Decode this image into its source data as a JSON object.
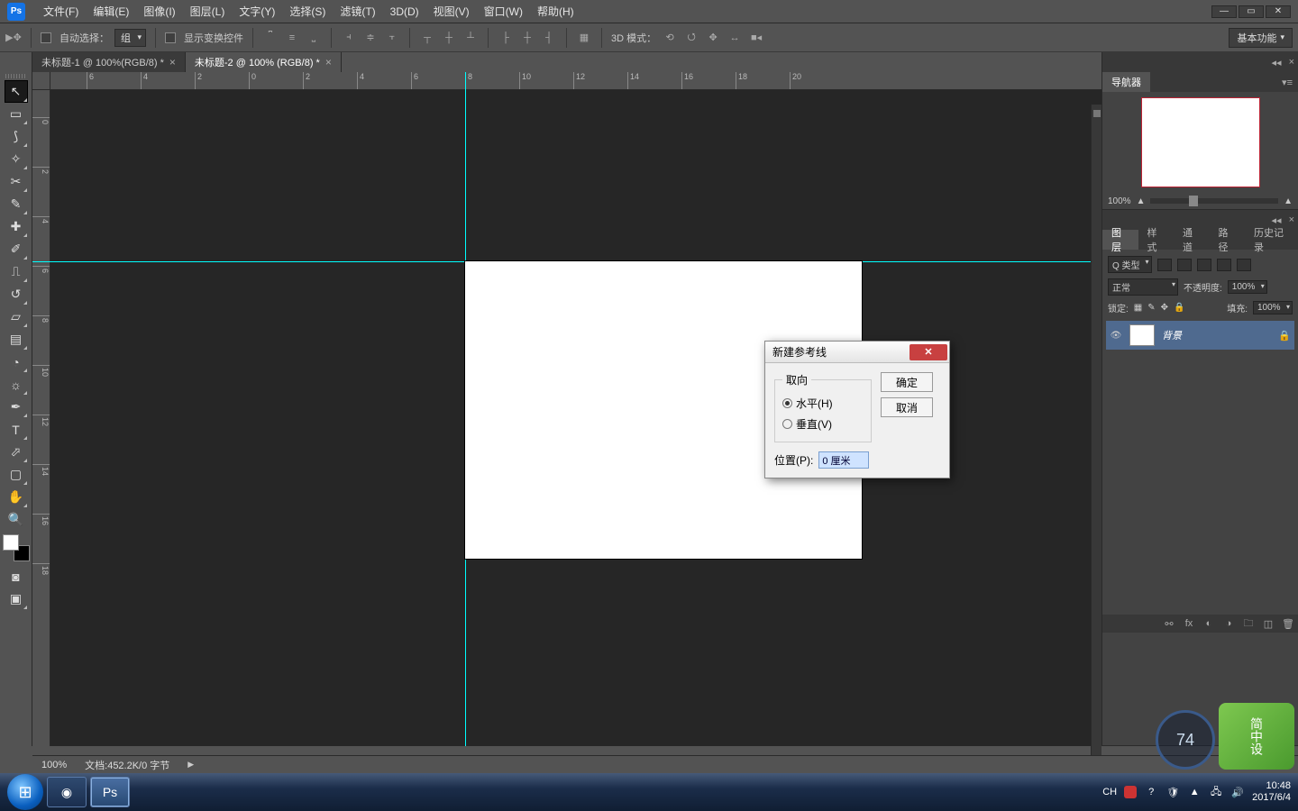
{
  "app": {
    "logo": "Ps",
    "workspace_preset": "基本功能"
  },
  "menu": {
    "file": "文件(F)",
    "edit": "编辑(E)",
    "image": "图像(I)",
    "layer": "图层(L)",
    "type": "文字(Y)",
    "select": "选择(S)",
    "filter": "滤镜(T)",
    "threeD": "3D(D)",
    "view": "视图(V)",
    "window": "窗口(W)",
    "help": "帮助(H)"
  },
  "options": {
    "auto_select": "自动选择：",
    "group": "组",
    "show_transform": "显示变换控件",
    "mode3d": "3D 模式："
  },
  "tabs": [
    {
      "label": "未标题-1 @ 100%(RGB/8) *",
      "active": false
    },
    {
      "label": "未标题-2 @ 100% (RGB/8) *",
      "active": true
    }
  ],
  "ruler_h": [
    "6",
    "4",
    "2",
    "0",
    "2",
    "4",
    "6",
    "8",
    "10",
    "12",
    "14",
    "16",
    "18",
    "20"
  ],
  "ruler_v": [
    "0",
    "2",
    "4",
    "6",
    "8",
    "10",
    "12",
    "14",
    "16",
    "18"
  ],
  "status": {
    "zoom": "100%",
    "doc": "文档:452.2K/0 字节",
    "arrow": "▶"
  },
  "panels": {
    "navigator": {
      "title": "导航器",
      "percent": "100%"
    },
    "layers": {
      "tabs": [
        "图层",
        "样式",
        "通道",
        "路径",
        "历史记录"
      ],
      "filter": "Q 类型",
      "blend": "正常",
      "opacity_label": "不透明度:",
      "opacity": "100%",
      "lock_label": "锁定:",
      "fill_label": "填充:",
      "fill": "100%",
      "layer_name": "背景"
    }
  },
  "dialog": {
    "title": "新建参考线",
    "orientation_legend": "取向",
    "horizontal": "水平(H)",
    "vertical": "垂直(V)",
    "position_label": "位置(P):",
    "position_value": "0 厘米",
    "ok": "确定",
    "cancel": "取消"
  },
  "taskbar": {
    "time": "10:48",
    "date": "2017/6/4",
    "ime": "CH"
  },
  "widget": {
    "gauge": "74",
    "label": "简中设"
  }
}
